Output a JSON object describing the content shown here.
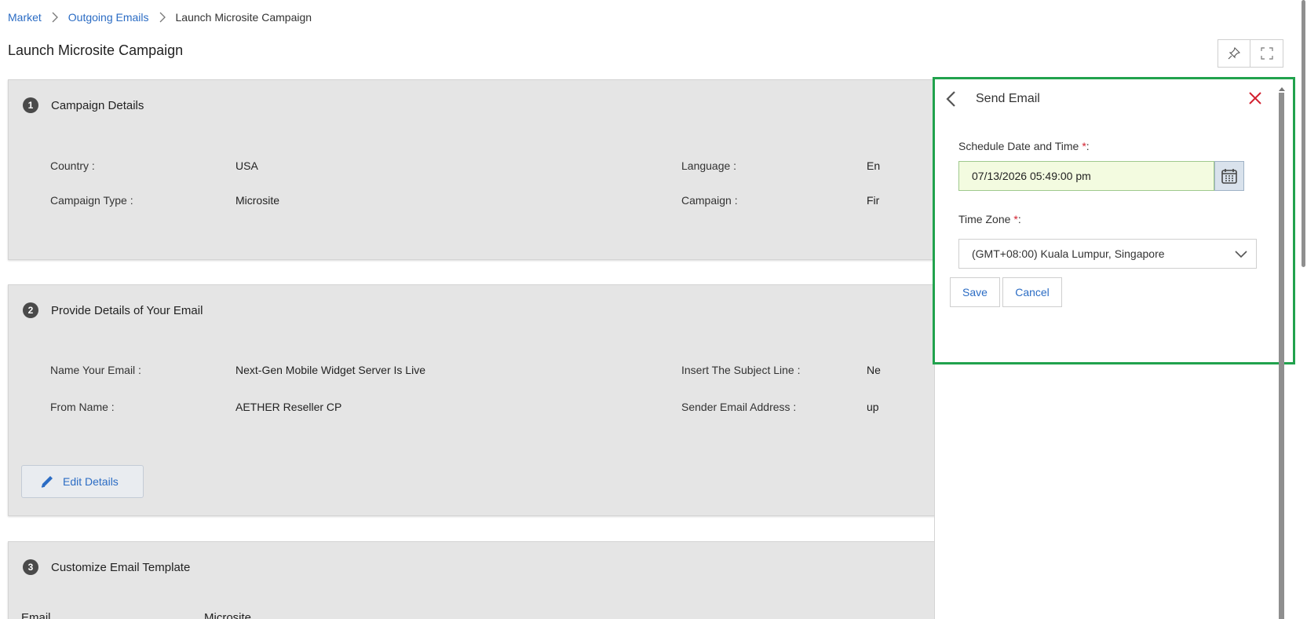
{
  "breadcrumb": {
    "items": [
      "Market",
      "Outgoing Emails"
    ],
    "current": "Launch Microsite Campaign"
  },
  "page": {
    "title": "Launch Microsite Campaign"
  },
  "sections": {
    "campaign_details": {
      "number": "1",
      "title": "Campaign Details",
      "country_label": "Country :",
      "country_value": "USA",
      "language_label": "Language :",
      "language_value": "En",
      "type_label": "Campaign Type :",
      "type_value": "Microsite",
      "campaign_label": "Campaign :",
      "campaign_value": "Fir"
    },
    "email_details": {
      "number": "2",
      "title": "Provide Details of Your Email",
      "name_label": "Name Your Email :",
      "name_value": "Next-Gen Mobile Widget Server Is Live",
      "subject_label": "Insert The Subject Line :",
      "subject_value": "Ne",
      "from_label": "From Name :",
      "from_value": "AETHER Reseller CP",
      "sender_label": "Sender Email Address :",
      "sender_value": "up",
      "edit_label": "Edit Details"
    },
    "template": {
      "number": "3",
      "title": "Customize Email Template",
      "col1": "Email",
      "col2": "Microsite"
    }
  },
  "panel": {
    "title": "Send Email",
    "schedule_label": "Schedule Date and Time",
    "schedule_suffix": ":",
    "schedule_value": "07/13/2026 05:49:00 pm",
    "timezone_label": "Time Zone",
    "timezone_suffix": ":",
    "timezone_value": "(GMT+08:00) Kuala Lumpur, Singapore",
    "required_mark": "*",
    "save_label": "Save",
    "cancel_label": "Cancel"
  },
  "colors": {
    "accent": "#2b6cc4",
    "highlight_border": "#21a24d",
    "close": "#d21f2e",
    "date_bg": "#f3fbe0"
  }
}
